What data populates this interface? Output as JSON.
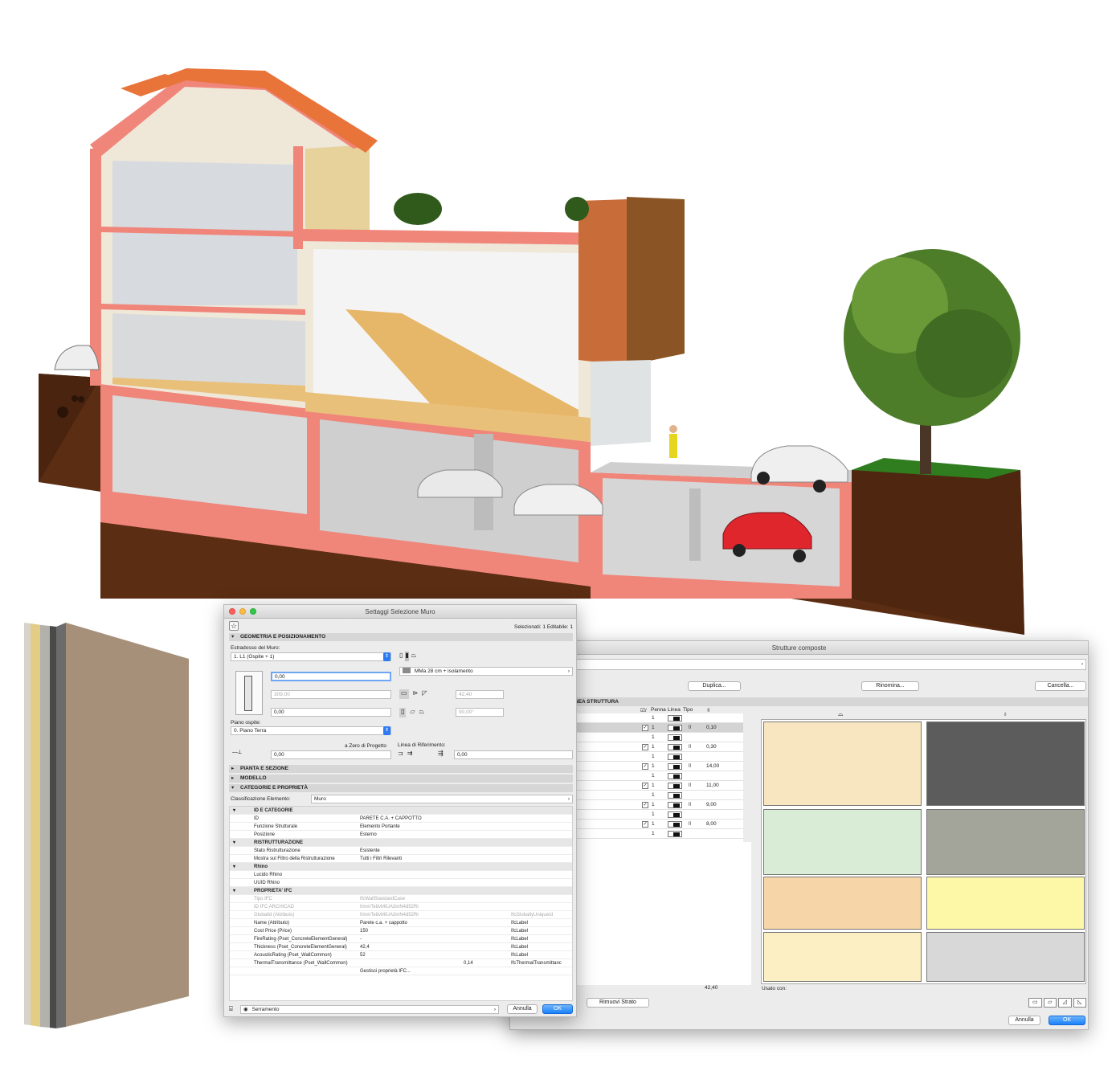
{
  "colors": {
    "soil": "#5a2c12",
    "wall_cut": "#f0857a",
    "roof": "#e8743a",
    "grass": "#2f7d1f",
    "accent_blue": "#1a82fb"
  },
  "composite_dialog": {
    "title": "Strutture composte",
    "name_field_fragment": "ento",
    "duplicate_button": "Duplica...",
    "rename_button": "Rinomina...",
    "delete_button": "Cancella...",
    "header_fragment": "NEA STRUTTURA",
    "col_headers": {
      "cb": "☑/",
      "pen": "Penna",
      "line": "Linea",
      "type": "Tipo"
    },
    "rows": [
      {
        "name": "opra: Linea Continua",
        "checkbox": false,
        "pen": "1",
        "thickness": "",
        "selected": false
      },
      {
        "name": "- Gesso",
        "checkbox": true,
        "pen": "1",
        "thickness": "0,10",
        "selected": true
      },
      {
        "name": "ontinua",
        "checkbox": false,
        "pen": "1",
        "thickness": "",
        "selected": false
      },
      {
        "name": "- Calce Sabbia",
        "checkbox": true,
        "pen": "1",
        "thickness": "0,30",
        "selected": false
      },
      {
        "name": "ntinua",
        "checkbox": false,
        "pen": "1",
        "thickness": "",
        "selected": false
      },
      {
        "name": "o Greypor",
        "checkbox": true,
        "pen": "1",
        "thickness": "14,00",
        "selected": false
      },
      {
        "name": "ntinua",
        "checkbox": false,
        "pen": "1",
        "thickness": "",
        "selected": false
      },
      {
        "name": "- Strutturale",
        "checkbox": true,
        "pen": "1",
        "thickness": "11,00",
        "selected": false
      },
      {
        "name": "ntinua",
        "checkbox": false,
        "pen": "1",
        "thickness": "",
        "selected": false
      },
      {
        "name": "o - Fibra Morbida",
        "checkbox": true,
        "pen": "1",
        "thickness": "9,00",
        "selected": false
      },
      {
        "name": "ntinua",
        "checkbox": false,
        "pen": "1",
        "thickness": "",
        "selected": false
      },
      {
        "name": "esso",
        "checkbox": true,
        "pen": "1",
        "thickness": "8,00",
        "selected": false
      },
      {
        "name": "otto: Linea Continua",
        "checkbox": false,
        "pen": "1",
        "thickness": "",
        "selected": false
      }
    ],
    "total_thickness": "42,40",
    "remove_layer_button": "Rimuovi Strato",
    "used_with_label": "Usato con:",
    "cancel_button": "Annulla",
    "ok_button": "OK"
  },
  "wall_dialog": {
    "title": "Settaggi Selezione Muro",
    "selection_status": "Selezionati: 1 Editabile: 1",
    "sections": {
      "geometry": "GEOMETRIA E POSIZIONAMENTO",
      "plan": "PIANTA E SEZIONE",
      "model": "MODELLO",
      "categories": "CATEGORIE E PROPRIETÀ"
    },
    "top_wall_label": "Estradosso del Muro:",
    "top_wall_value": "1. L1 (Ospite + 1)",
    "composite_value": "MMa 28 cm + isolamento",
    "height_offset": "0,00",
    "height_value": "309,00",
    "base_offset": "0,00",
    "thickness_value": "42,40",
    "angle_value": "90,00°",
    "home_story_label": "Piano ospite:",
    "home_story_value": "0. Piano Terra",
    "to_project_zero_label": "a Zero di Progetto",
    "project_zero_value": "0,00",
    "ref_line_label": "Linea di Riferimento:",
    "ref_offset_value": "0,00",
    "classification_label": "Classificazione Elemento:",
    "classification_value": "Muro",
    "properties": [
      {
        "type": "group",
        "c1": "ID E CATEGORIE"
      },
      {
        "type": "row",
        "c1": "ID",
        "c2": "PARETE C.A. + CAPPOTTO",
        "c3": "",
        "c4": ""
      },
      {
        "type": "row",
        "c1": "Funzione Strutturale",
        "c2": "Elemento Portante",
        "c3": "",
        "c4": ""
      },
      {
        "type": "row",
        "c1": "Posizione",
        "c2": "Esterno",
        "c3": "",
        "c4": ""
      },
      {
        "type": "group",
        "c1": "RISTRUTTURAZIONE"
      },
      {
        "type": "row",
        "c1": "Stato Ristrutturazione",
        "c2": "Esistente",
        "c3": "",
        "c4": ""
      },
      {
        "type": "row",
        "c1": "Mostra sul Filtro della Ristrutturazione",
        "c2": "Tutti i Filtri Rilevanti",
        "c3": "",
        "c4": ""
      },
      {
        "type": "group",
        "c1": "Rhino"
      },
      {
        "type": "row",
        "c1": "Lucido Rhino",
        "c2": "",
        "c3": "",
        "c4": ""
      },
      {
        "type": "row",
        "c1": "UUID Rhino",
        "c2": "",
        "c3": "",
        "c4": ""
      },
      {
        "type": "group",
        "c1": "PROPRIETA' IFC"
      },
      {
        "type": "dim",
        "c1": "Tipo IFC",
        "c2": "IfcWallStandardCase",
        "c3": "",
        "c4": ""
      },
      {
        "type": "dim",
        "c1": "ID IFC ARCHICAD",
        "c2": "0mmTe8vMIUA3mN4d52Rr",
        "c3": "",
        "c4": ""
      },
      {
        "type": "dim",
        "c1": "GlobalId (Attributo)",
        "c2": "0mmTe8vMIUA3mN4d52Rr",
        "c3": "",
        "c4": "IfcGloballyUniqueId"
      },
      {
        "type": "row",
        "c1": "Name (Attributo)",
        "c2": "Parete c.a. + cappotto",
        "c3": "",
        "c4": "IfcLabel"
      },
      {
        "type": "row",
        "c1": "Cost Price (Price)",
        "c2": "150",
        "c3": "",
        "c4": "IfcLabel"
      },
      {
        "type": "row",
        "c1": "FireRating (Pset_ConcreteElementGeneral)",
        "c2": "-",
        "c3": "",
        "c4": "IfcLabel"
      },
      {
        "type": "row",
        "c1": "Thickness (Pset_ConcreteElementGeneral)",
        "c2": "42,4",
        "c3": "",
        "c4": "IfcLabel"
      },
      {
        "type": "row",
        "c1": "AcousticRating (Pset_WallCommon)",
        "c2": "52",
        "c3": "",
        "c4": "IfcLabel"
      },
      {
        "type": "row",
        "c1": "ThermalTransmittance (Pset_WallCommon)",
        "c2": "",
        "c3": "0,14",
        "c4": "IfcThermalTransmittanc"
      },
      {
        "type": "row",
        "c1": "",
        "c2": "Gestisci proprietà IFC...",
        "c3": "",
        "c4": ""
      }
    ],
    "favorite_value": "Serramento",
    "cancel_button": "Annulla",
    "ok_button": "OK"
  }
}
